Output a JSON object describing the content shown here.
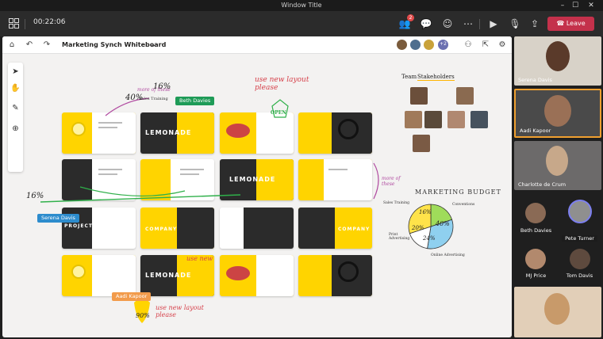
{
  "window": {
    "title": "Window Title",
    "min": "–",
    "max": "☐",
    "close": "✕"
  },
  "topbar": {
    "timer": "00:22:06",
    "people_badge": "2",
    "leave_label": "Leave"
  },
  "whiteboard": {
    "name": "Marketing Synch Whiteboard",
    "more_avatars": "+2",
    "slide_logo_text": "LEMONADE",
    "slide_project_text": "PROJECT",
    "slide_company_text": "COMPANY",
    "annotations": {
      "sales_training_pct": "16%",
      "sales_training_label": "Sales Training",
      "forty": "40%",
      "more_of_these": "more of these",
      "use_new_layout_top": "use new layout please",
      "open_label": "OPEN",
      "sixteen_left": "16%",
      "more_of_these_2": "more of these",
      "use_new_center": "use new",
      "use_new_bottom": "use new layout please",
      "ninety": "90%",
      "team": "Team",
      "stakeholders": "Stakeholders"
    },
    "cursors": {
      "beth": "Beth Davies",
      "serena": "Serena Davis",
      "aadi": "Aadi Kapoor"
    },
    "budget": {
      "title": "MARKETING BUDGET",
      "labels": {
        "sales": "Sales Training",
        "conventions": "Conventions",
        "print": "Print Advertising",
        "online": "Online Advertising"
      },
      "values": {
        "sales": "16%",
        "conventions": "40%",
        "print": "20%",
        "online": "24%"
      }
    }
  },
  "participants": {
    "tiles": [
      "Serena Davis",
      "Aadi Kapoor",
      "Charlotte de Crum"
    ],
    "grid": [
      "Beth Davies",
      "Pete Turner",
      "MJ Price",
      "Tom Davis"
    ]
  },
  "colors": {
    "leave": "#c4314b",
    "yellow": "#ffd400",
    "beth": "#1e9b57",
    "serena": "#2d8ccd",
    "aadi": "#f29b4b"
  }
}
